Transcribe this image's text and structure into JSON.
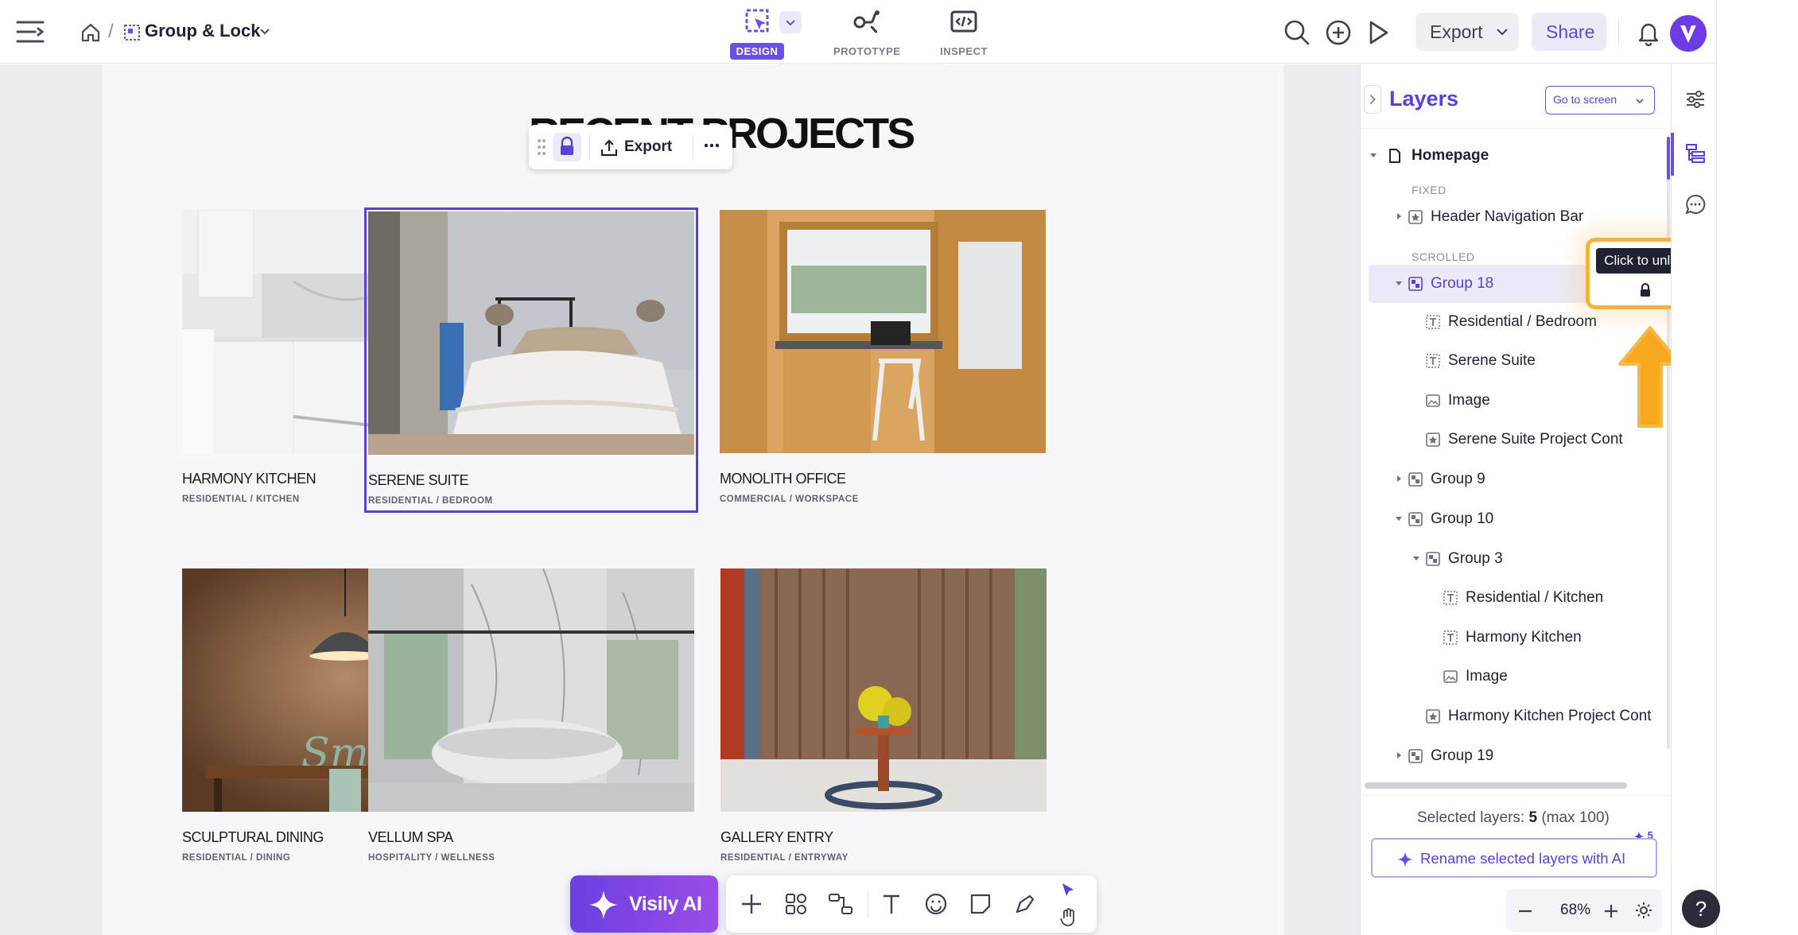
{
  "topbar": {
    "breadcrumb_separator": "/",
    "project_name": "Group & Lock",
    "modes": [
      {
        "label": "DESIGN",
        "active": true,
        "icon": "design-icon"
      },
      {
        "label": "PROTOTYPE",
        "active": false,
        "icon": "prototype-icon"
      },
      {
        "label": "INSPECT",
        "active": false,
        "icon": "inspect-icon"
      }
    ],
    "export_label": "Export",
    "share_label": "Share",
    "accent": "#6b4ee6"
  },
  "canvas": {
    "heading": "RECENT PROJECTS",
    "floating_toolbar": {
      "export_label": "Export"
    },
    "cards": [
      {
        "title": "HARMONY KITCHEN",
        "subtitle": "RESIDENTIAL / KITCHEN",
        "selected": false
      },
      {
        "title": "SERENE SUITE",
        "subtitle": "RESIDENTIAL / BEDROOM",
        "selected": true
      },
      {
        "title": "MONOLITH OFFICE",
        "subtitle": "COMMERCIAL / WORKSPACE",
        "selected": false
      },
      {
        "title": "SCULPTURAL DINING",
        "subtitle": "RESIDENTIAL / DINING",
        "selected": false
      },
      {
        "title": "VELLUM SPA",
        "subtitle": "HOSPITALITY / WELLNESS",
        "selected": false
      },
      {
        "title": "GALLERY ENTRY",
        "subtitle": "RESIDENTIAL / ENTRYWAY",
        "selected": false
      }
    ],
    "ai_button_label": "Visily AI"
  },
  "layers": {
    "title": "Layers",
    "goto_label": "Go to screen",
    "sections": {
      "fixed": "FIXED",
      "scrolled": "SCROLLED"
    },
    "items": [
      {
        "name": "Homepage",
        "icon": "page-icon"
      },
      {
        "name": "Header Navigation Bar",
        "icon": "component-icon"
      },
      {
        "name": "Group 18",
        "icon": "group-icon"
      },
      {
        "name": "Residential / Bedroom",
        "icon": "text-icon"
      },
      {
        "name": "Serene Suite",
        "icon": "text-icon"
      },
      {
        "name": "Image",
        "icon": "image-icon"
      },
      {
        "name": "Serene Suite Project Cont",
        "icon": "component-icon"
      },
      {
        "name": "Group 9",
        "icon": "group-icon"
      },
      {
        "name": "Group 10",
        "icon": "group-icon"
      },
      {
        "name": "Group 3",
        "icon": "group-icon"
      },
      {
        "name": "Residential / Kitchen",
        "icon": "text-icon"
      },
      {
        "name": "Harmony Kitchen",
        "icon": "text-icon"
      },
      {
        "name": "Image",
        "icon": "image-icon"
      },
      {
        "name": "Harmony Kitchen Project Cont",
        "icon": "component-icon"
      },
      {
        "name": "Group 19",
        "icon": "group-icon"
      }
    ],
    "tooltip": "Click to unlock",
    "selected_label": "Selected layers:",
    "selected_count": "5",
    "selected_max": "(max 100)",
    "rename_label": "Rename selected layers with AI",
    "ai_credits": "5",
    "zoom": "68%"
  },
  "help_label": "?"
}
